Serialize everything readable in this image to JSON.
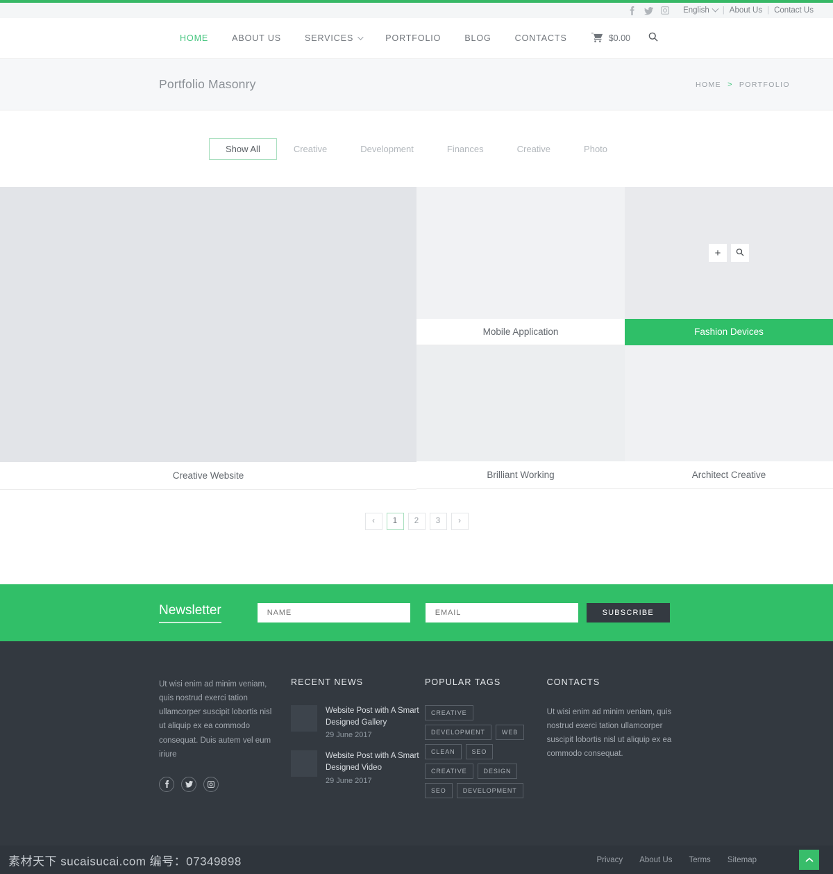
{
  "topbar": {
    "socials": [
      {
        "name": "facebook-icon",
        "label": "f"
      },
      {
        "name": "twitter-icon",
        "label": "t"
      },
      {
        "name": "instagram-icon",
        "label": "i"
      }
    ],
    "language": "English",
    "links": [
      "About Us",
      "Contact Us"
    ],
    "separator": "|"
  },
  "nav": {
    "items": [
      {
        "label": "HOME",
        "active": true,
        "caret": false
      },
      {
        "label": "ABOUT US",
        "active": false,
        "caret": false
      },
      {
        "label": "SERVICES",
        "active": false,
        "caret": true
      },
      {
        "label": "PORTFOLIO",
        "active": false,
        "caret": false
      },
      {
        "label": "BLOG",
        "active": false,
        "caret": false
      },
      {
        "label": "CONTACTS",
        "active": false,
        "caret": false
      }
    ],
    "cart_total": "$0.00",
    "cart_icon": "cart-icon",
    "search_icon": "search-icon"
  },
  "page_header": {
    "title": "Portfolio Masonry",
    "breadcrumbs": [
      "HOME",
      "PORTFOLIO"
    ],
    "separator": ">"
  },
  "filters": [
    {
      "label": "Show All",
      "active": true
    },
    {
      "label": "Creative",
      "active": false
    },
    {
      "label": "Development",
      "active": false
    },
    {
      "label": "Finances",
      "active": false
    },
    {
      "label": "Creative",
      "active": false
    },
    {
      "label": "Photo",
      "active": false
    }
  ],
  "portfolio": {
    "hover": {
      "add_label": "+",
      "zoom_icon": "magnifier-icon"
    },
    "items": [
      {
        "title": "Creative Website",
        "highlight": false
      },
      {
        "title": "Mobile Application",
        "highlight": false
      },
      {
        "title": "Fashion Devices",
        "highlight": true
      },
      {
        "title": "Brilliant Working",
        "highlight": false
      },
      {
        "title": "Architect Creative",
        "highlight": false
      }
    ]
  },
  "pagination": {
    "prev": "‹",
    "next": "›",
    "pages": [
      {
        "label": "1",
        "active": true
      },
      {
        "label": "2",
        "active": false
      },
      {
        "label": "3",
        "active": false
      }
    ]
  },
  "newsletter": {
    "title": "Newsletter",
    "name_placeholder": "NAME",
    "name_value": "",
    "email_placeholder": "EMAIL",
    "email_value": "",
    "subscribe_label": "SUBSCRIBE"
  },
  "footer": {
    "about": {
      "text": "Ut wisi enim ad minim veniam, quis nostrud exerci tation ullamcorper suscipit lobortis nisl ut aliquip ex ea commodo consequat. Duis autem vel eum iriure",
      "socials": [
        {
          "name": "facebook-icon"
        },
        {
          "name": "twitter-icon"
        },
        {
          "name": "instagram-icon"
        }
      ]
    },
    "recent_news": {
      "heading": "RECENT NEWS",
      "items": [
        {
          "title": "Website Post with A Smart Designed Gallery",
          "date": "29 June 2017"
        },
        {
          "title": "Website Post with A Smart Designed Video",
          "date": "29 June 2017"
        }
      ]
    },
    "popular_tags": {
      "heading": "POPULAR TAGS",
      "tags": [
        "CREATIVE",
        "DEVELOPMENT",
        "WEB",
        "CLEAN",
        "SEO",
        "CREATIVE",
        "DESIGN",
        "SEO",
        "DEVELOPMENT"
      ]
    },
    "contacts": {
      "heading": "CONTACTS",
      "text": "Ut wisi enim ad minim veniam, quis nostrud exerci tation ullamcorper suscipit lobortis nisl ut aliquip ex ea commodo consequat."
    },
    "bottom_links": [
      "Privacy",
      "About Us",
      "Terms",
      "Sitemap"
    ],
    "to_top_icon": "chevron-up-icon"
  },
  "watermark": "素材天下 sucaisucai.com 编号：07349898",
  "colors": {
    "accent_green": "#31bf68",
    "nav_active": "#41c47c",
    "footer_bg": "#333940",
    "footer_bottom_bg": "#2f353c",
    "subscribe_bg": "#343a41"
  }
}
